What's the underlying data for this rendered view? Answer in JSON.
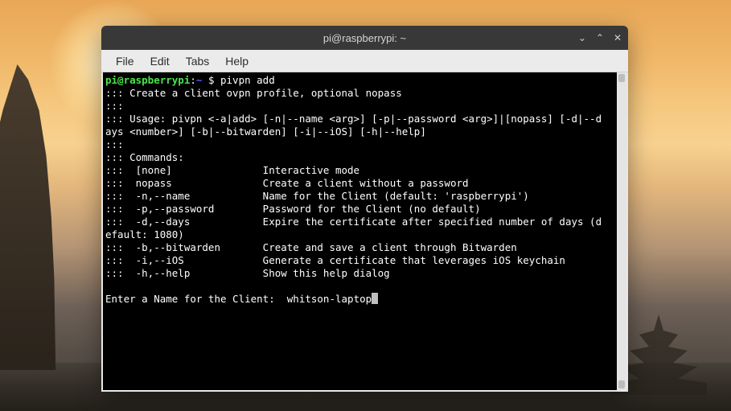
{
  "window": {
    "title": "pi@raspberrypi: ~"
  },
  "menu": {
    "file": "File",
    "edit": "Edit",
    "tabs": "Tabs",
    "help": "Help"
  },
  "prompt": {
    "userhost": "pi@raspberrypi",
    "colon": ":",
    "cwd": "~",
    "sigil": " $ ",
    "command": "pivpn add"
  },
  "lines": {
    "l1": "::: Create a client ovpn profile, optional nopass",
    "l2": ":::",
    "l3": "::: Usage: pivpn <-a|add> [-n|--name <arg>] [-p|--password <arg>]|[nopass] [-d|--days <number>] [-b|--bitwarden] [-i|--iOS] [-h|--help]",
    "l4": ":::",
    "l5": "::: Commands:",
    "l6": ":::  [none]               Interactive mode",
    "l7": ":::  nopass               Create a client without a password",
    "l8": ":::  -n,--name            Name for the Client (default: 'raspberrypi')",
    "l9": ":::  -p,--password        Password for the Client (no default)",
    "l10": ":::  -d,--days            Expire the certificate after specified number of days (default: 1080)",
    "l11": ":::  -b,--bitwarden       Create and save a client through Bitwarden",
    "l12": ":::  -i,--iOS             Generate a certificate that leverages iOS keychain",
    "l13": ":::  -h,--help            Show this help dialog",
    "blank": "",
    "inputPrompt": "Enter a Name for the Client:  ",
    "inputValue": "whitson-laptop"
  }
}
